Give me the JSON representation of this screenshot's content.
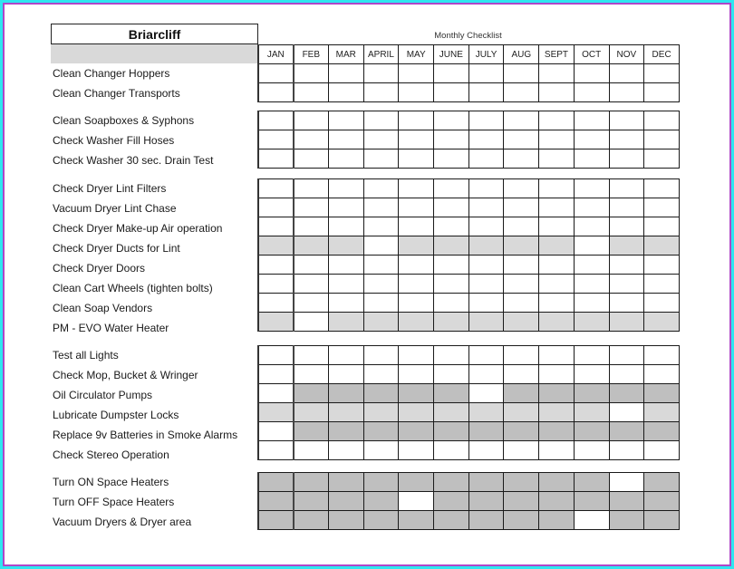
{
  "title": "Briarcliff",
  "subtitle": "Monthly Checklist",
  "months": [
    "JAN",
    "FEB",
    "MAR",
    "APRIL",
    "MAY",
    "JUNE",
    "JULY",
    "AUG",
    "SEPT",
    "OCT",
    "NOV",
    "DEC"
  ],
  "colors": {
    "white": "#ffffff",
    "light_gray": "#d9d9d9",
    "dark_gray": "#bfbfbf",
    "frame_outer": "#2ee6f0",
    "frame_inner": "#b046c8"
  },
  "cell_legend": {
    "W": "white (task due)",
    "L": "light gray (not due)",
    "D": "dark gray (not due)"
  },
  "groups": [
    {
      "tasks": [
        {
          "label": "Clean Changer Hoppers",
          "cells": "WWWWWWWWWWWW"
        },
        {
          "label": "Clean Changer Transports",
          "cells": "WWWWWWWWWWWW"
        }
      ]
    },
    {
      "tasks": [
        {
          "label": "Clean Soapboxes & Syphons",
          "cells": "WWWWWWWWWWWW"
        },
        {
          "label": "Check Washer Fill Hoses",
          "cells": "WWWWWWWWWWWW"
        },
        {
          "label": "Check Washer 30 sec. Drain Test",
          "cells": "WWWWWWWWWWWW"
        }
      ]
    },
    {
      "tasks": [
        {
          "label": "Check Dryer Lint Filters",
          "cells": "WWWWWWWWWWWW"
        },
        {
          "label": "Vacuum Dryer Lint Chase",
          "cells": "WWWWWWWWWWWW"
        },
        {
          "label": "Check Dryer Make-up Air operation",
          "cells": "WWWWWWWWWWWW"
        },
        {
          "label": "Check Dryer Ducts for Lint",
          "cells": "LLLWLLLLLWLL"
        },
        {
          "label": "Check Dryer Doors",
          "cells": "WWWWWWWWWWWW"
        },
        {
          "label": "Clean Cart Wheels (tighten bolts)",
          "cells": "WWWWWWWWWWWW"
        },
        {
          "label": "Clean Soap Vendors",
          "cells": "WWWWWWWWWWWW"
        },
        {
          "label": "PM - EVO Water Heater",
          "cells": "LWLLLLLLLLLL"
        }
      ]
    },
    {
      "tasks": [
        {
          "label": "Test all Lights",
          "cells": "WWWWWWWWWWWW"
        },
        {
          "label": "Check Mop, Bucket & Wringer",
          "cells": "WWWWWWWWWWWW"
        },
        {
          "label": "Oil Circulator Pumps",
          "cells": "WDDDDDWDDDDD"
        },
        {
          "label": "Lubricate Dumpster Locks",
          "cells": "LLLLLLLLLLWL"
        },
        {
          "label": "Replace 9v Batteries in Smoke Alarms",
          "cells": "WDDDDDDDDDDD"
        },
        {
          "label": "Check Stereo Operation",
          "cells": "WWWWWWWWWWWW"
        }
      ]
    },
    {
      "tasks": [
        {
          "label": "Turn ON Space Heaters",
          "cells": "DDDDDDDDDDWD"
        },
        {
          "label": "Turn OFF Space Heaters",
          "cells": "DDDDWDDDDDDD"
        },
        {
          "label": "Vacuum Dryers & Dryer area",
          "cells": "DDDDDDDDDWDD"
        }
      ]
    }
  ]
}
